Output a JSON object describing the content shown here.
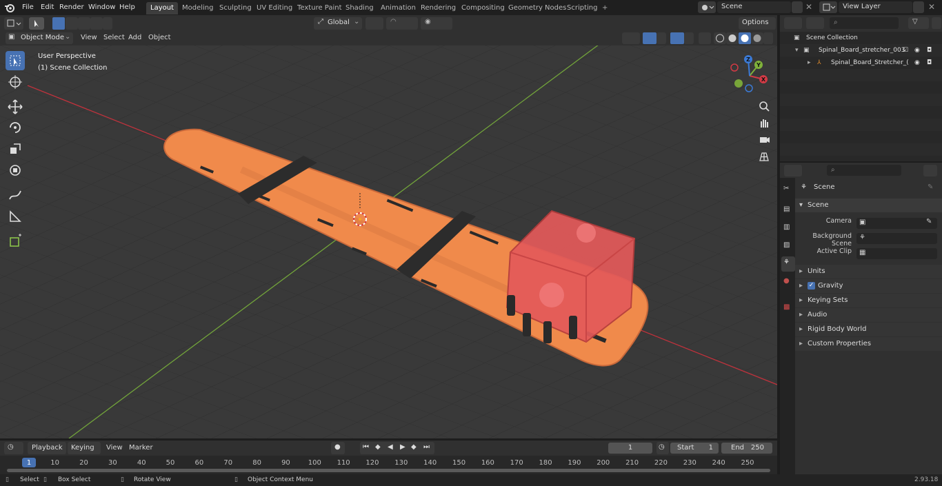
{
  "menu": [
    "File",
    "Edit",
    "Render",
    "Window",
    "Help"
  ],
  "workspaces": [
    "Layout",
    "Modeling",
    "Sculpting",
    "UV Editing",
    "Texture Paint",
    "Shading",
    "Animation",
    "Rendering",
    "Compositing",
    "Geometry Nodes",
    "Scripting"
  ],
  "active_workspace": "Layout",
  "scene_name": "Scene",
  "view_layer": "View Layer",
  "viewport": {
    "mode": "Object Mode",
    "menus": [
      "View",
      "Select",
      "Add",
      "Object"
    ],
    "transform_orientation": "Global",
    "options_label": "Options",
    "overlay_title": "User Perspective",
    "overlay_subtitle": "(1) Scene Collection",
    "gizmo_axes": {
      "x": "X",
      "y": "Y",
      "z": "Z"
    }
  },
  "outliner": {
    "root": "Scene Collection",
    "items": [
      "Spinal_Board_stretcher_003",
      "Spinal_Board_Stretcher_("
    ]
  },
  "properties": {
    "context": "Scene",
    "panel_title": "Scene",
    "fields": [
      {
        "label": "Camera"
      },
      {
        "label": "Background Scene"
      },
      {
        "label": "Active Clip"
      }
    ],
    "subpanels": [
      "Units",
      "Gravity",
      "Keying Sets",
      "Audio",
      "Rigid Body World",
      "Custom Properties"
    ],
    "gravity_checked": true
  },
  "timeline": {
    "menus": [
      "Playback",
      "Keying",
      "View",
      "Marker"
    ],
    "current_frame": "1",
    "start_label": "Start",
    "start_value": "1",
    "end_label": "End",
    "end_value": "250",
    "ruler": [
      "1",
      "10",
      "20",
      "30",
      "40",
      "50",
      "60",
      "70",
      "80",
      "90",
      "100",
      "110",
      "120",
      "130",
      "140",
      "150",
      "160",
      "170",
      "180",
      "190",
      "200",
      "210",
      "220",
      "230",
      "240",
      "250"
    ]
  },
  "statusbar": {
    "select": "Select",
    "box_select": "Box Select",
    "rotate_view": "Rotate View",
    "context_menu": "Object Context Menu",
    "version": "2.93.18"
  },
  "colors": {
    "accent": "#4772b3",
    "board_orange": "#f08a4b",
    "box_red": "#e45a5a",
    "x_axis": "#d23a45",
    "y_axis": "#7fb13a"
  }
}
